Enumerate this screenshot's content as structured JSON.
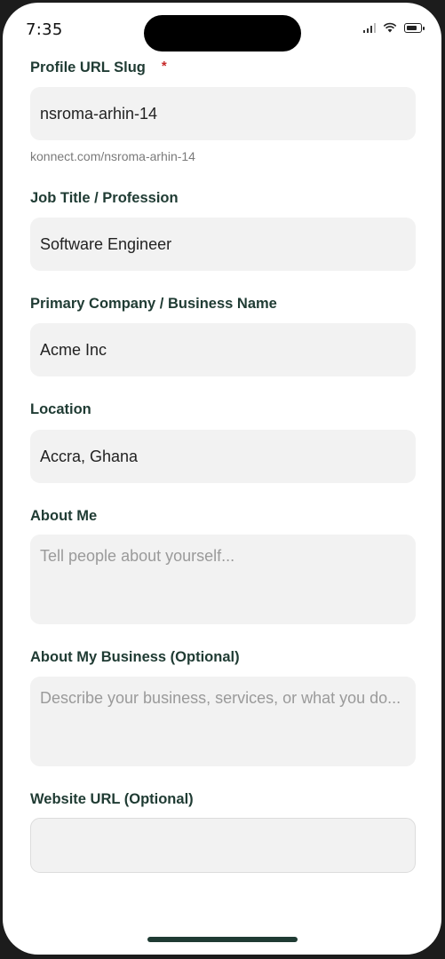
{
  "status_bar": {
    "time": "7:35"
  },
  "form": {
    "profile_slug": {
      "label": "Profile URL Slug",
      "required_marker": "*",
      "value": "nsroma-arhin-14",
      "hint": "konnect.com/nsroma-arhin-14"
    },
    "job_title": {
      "label": "Job Title / Profession",
      "value": "Software Engineer"
    },
    "company": {
      "label": "Primary Company / Business Name",
      "value": "Acme Inc"
    },
    "location": {
      "label": "Location",
      "value": "Accra, Ghana"
    },
    "about_me": {
      "label": "About Me",
      "placeholder": "Tell people about yourself..."
    },
    "about_business": {
      "label": "About My Business (Optional)",
      "placeholder": "Describe your business, services, or what you do..."
    },
    "website": {
      "label": "Website URL (Optional)",
      "value": ""
    }
  }
}
